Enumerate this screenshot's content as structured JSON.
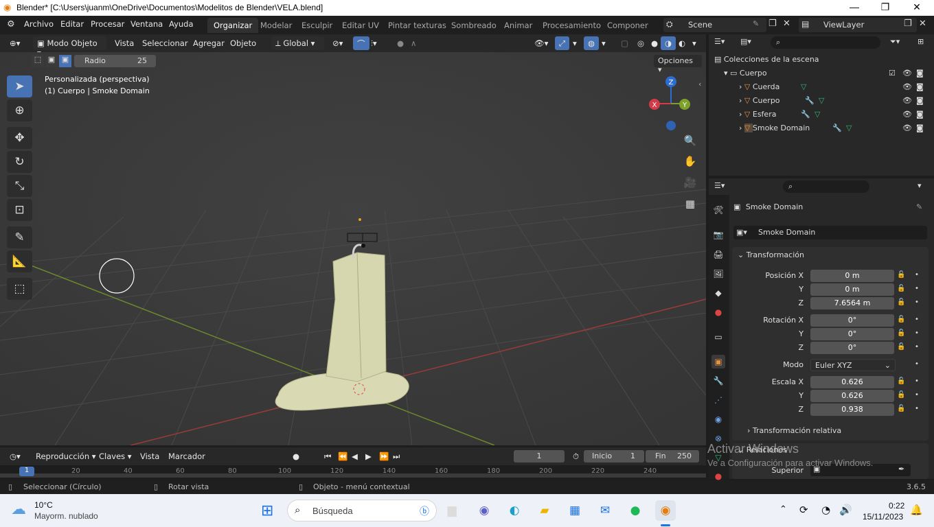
{
  "window": {
    "title": "Blender* [C:\\Users\\juanm\\OneDrive\\Documentos\\Modelitos de Blender\\VELA.blend]"
  },
  "menu": {
    "items": [
      "Archivo",
      "Editar",
      "Procesar",
      "Ventana",
      "Ayuda"
    ]
  },
  "workspaces": [
    "Organizar",
    "Modelar",
    "Esculpir",
    "Editar UV",
    "Pintar texturas",
    "Sombreado",
    "Animar",
    "Procesamiento",
    "Componer"
  ],
  "scene": {
    "name": "Scene",
    "view_layer": "ViewLayer"
  },
  "viewport_header": {
    "mode": "Modo Objeto",
    "menus": [
      "Vista",
      "Seleccionar",
      "Agregar",
      "Objeto"
    ],
    "orientation": "Global"
  },
  "tool_settings": {
    "radius_label": "Radio",
    "radius_value": "25",
    "options": "Opciones"
  },
  "viewport": {
    "overlay_line1": "Personalizada (perspectiva)",
    "overlay_line2": "(1) Cuerpo | Smoke Domain",
    "gizmo_x": "X",
    "gizmo_y": "Y",
    "gizmo_z": "Z"
  },
  "outliner": {
    "root": "Colecciones de la escena",
    "collection": "Cuerpo",
    "items": [
      {
        "name": "Cuerda"
      },
      {
        "name": "Cuerpo"
      },
      {
        "name": "Esfera"
      },
      {
        "name": "Smoke Domain"
      }
    ]
  },
  "properties": {
    "object_name": "Smoke Domain",
    "datablock": "Smoke Domain",
    "panel_transform": "Transformación",
    "rows": [
      {
        "label": "Posición X",
        "value": "0 m"
      },
      {
        "label": "Y",
        "value": "0 m"
      },
      {
        "label": "Z",
        "value": "7.6564 m"
      },
      {
        "label": "Rotación X",
        "value": "0°"
      },
      {
        "label": "Y",
        "value": "0°"
      },
      {
        "label": "Z",
        "value": "0°"
      }
    ],
    "mode_label": "Modo",
    "mode_value": "Euler XYZ",
    "scale_rows": [
      {
        "label": "Escala X",
        "value": "0.626"
      },
      {
        "label": "Y",
        "value": "0.626"
      },
      {
        "label": "Z",
        "value": "0.938"
      }
    ],
    "delta_transform": "Transformación relativa",
    "relations": "Relaciones",
    "parent_label": "Superior"
  },
  "timeline": {
    "menus": [
      "Reproducción",
      "Claves",
      "Vista",
      "Marcador"
    ],
    "current_frame": "1",
    "start_label": "Inicio",
    "start": "1",
    "end_label": "Fin",
    "end": "250",
    "ticks": [
      "1",
      "20",
      "40",
      "60",
      "80",
      "100",
      "120",
      "140",
      "160",
      "180",
      "200",
      "220",
      "240"
    ]
  },
  "statusbar": {
    "left": "Seleccionar (Círculo)",
    "middle": "Rotar vista",
    "right": "Objeto - menú contextual",
    "version": "3.6.5"
  },
  "watermark": {
    "line1": "Activar Windows",
    "line2": "Ve a Configuración para activar Windows."
  },
  "taskbar": {
    "weather_temp": "10°C",
    "weather_desc": "Mayorm. nublado",
    "search": "Búsqueda",
    "time": "0:22",
    "date": "15/11/2023"
  }
}
